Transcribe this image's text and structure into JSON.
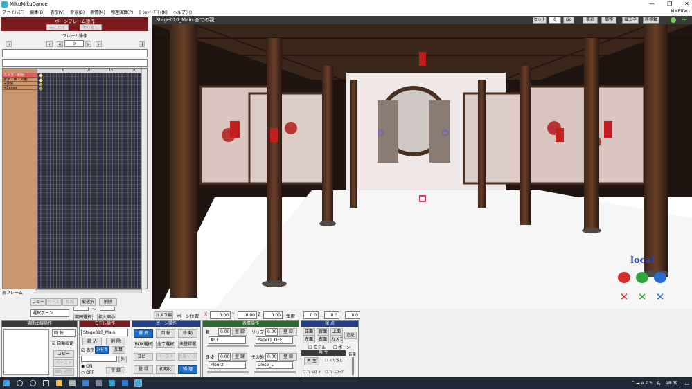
{
  "window": {
    "title": "MikuMikuDance",
    "controls": [
      "—",
      "❐",
      "✕"
    ]
  },
  "menu": {
    "items": [
      "ファイル(F)",
      "編集(D)",
      "表示(V)",
      "背景(B)",
      "表情(M)",
      "物理演算(P)",
      "ﾓｰｼｮﾝｷｬﾌﾟﾁｬ(K)",
      "ヘルプ(H)"
    ],
    "right": "MMEffect"
  },
  "bone_frame": {
    "header": "ボーンフレーム操作",
    "undo": "元に戻す",
    "redo": "やり直し",
    "frame_header": "フレーム操作",
    "frame_value": "0",
    "ruler": [
      "5",
      "10",
      "15",
      "20"
    ],
    "tracks": [
      "カメラ・照明",
      "表示・IK・外観",
      "+表情",
      "+Bones"
    ],
    "current_frame_label": "現フレーム"
  },
  "bone_ops": {
    "copy": "コピー",
    "paste": "ペースト",
    "reverse": "反転",
    "vertical": "縦選択",
    "delete": "削除",
    "select_bone": "選択ボーン",
    "tilde": "〜",
    "range_select": "範囲選択",
    "zoom": "拡大縮小"
  },
  "viewport": {
    "title": "Stage010_Main:全ての親",
    "seek_label": "セット",
    "frame": "0",
    "go": "Go",
    "buttons": [
      "裏影",
      "情報",
      "省エネ",
      "座標軸"
    ],
    "local_label": "local"
  },
  "bottom": {
    "camera_tab": "カメラ編",
    "bone_pos_label": "ボーン位置",
    "x_label": "X",
    "x": "0.00",
    "y_label": "Y",
    "y": "0.00",
    "z_label": "Z",
    "z": "0.00",
    "angle_label": "角度",
    "ax": "0.0",
    "ay": "0.0",
    "az": "0.0"
  },
  "interp": {
    "header": "補間曲線操作",
    "rotate": "回 転",
    "auto": "自動設定",
    "copy": "コピー",
    "paste": "ペースト",
    "linear": "線形補間"
  },
  "model": {
    "header": "モデル操作",
    "selected": "Stage010_Main",
    "load": "読 込",
    "delete": "削 除",
    "show": "表示",
    "mode": "ｼｬﾄﾞｳ",
    "add": "加算",
    "on": "ON",
    "off": "OFF",
    "register": "登 録",
    "outer": "外"
  },
  "bone": {
    "header": "ボーン操作",
    "select": "選 択",
    "rotate": "回 転",
    "move": "移 動",
    "box": "BOX選択",
    "all": "全て選択",
    "unreg": "未登録選",
    "copy": "コピー",
    "paste": "ペースト",
    "reverse": "反転ﾍﾟｰｽﾄ",
    "register": "登 録",
    "init": "初期化",
    "physics": "物 理"
  },
  "morph": {
    "header": "表情操作",
    "eye": "目",
    "eye_val": "0.000",
    "lip": "リップ",
    "lip_val": "0.000",
    "eye_sel": "AL1",
    "lip_sel": "Paper1_OFF",
    "brow": "まゆ",
    "brow_val": "0.000",
    "other": "その他",
    "other_val": "0.000",
    "brow_sel": "Floor2",
    "other_sel": "Close_L",
    "register": "登 録"
  },
  "view": {
    "header": "視 点",
    "front": "正面",
    "back": "背面",
    "top": "上面",
    "left": "左面",
    "right": "右面",
    "camera": "カメラ",
    "follow": "追従",
    "model": "モデル",
    "bone": "ボーン"
  },
  "play": {
    "header": "再 生",
    "play": "再 生",
    "repeat": "くり返し",
    "from": "ﾌﾚｰﾑｽﾀｰﾄ",
    "to": "ﾌﾚｰﾑｽﾄｯﾌﾟ",
    "volume": "音量"
  },
  "taskbar": {
    "time": "18:49",
    "lang": "A"
  }
}
